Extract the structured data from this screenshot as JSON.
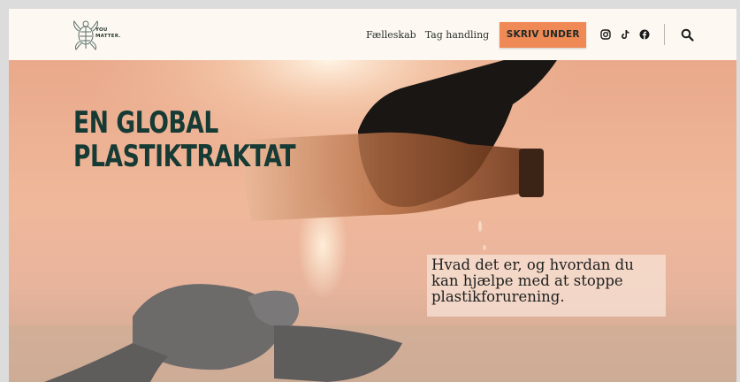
{
  "logo": {
    "line1": "YOU",
    "line2": "MATTER."
  },
  "nav": {
    "links": [
      "Fælleskab",
      "Tag handling"
    ],
    "cta_label": "SKRIV UNDER"
  },
  "icons": [
    "instagram-icon",
    "tiktok-icon",
    "facebook-icon",
    "search-icon"
  ],
  "hero": {
    "title_line1": "EN GLOBAL",
    "title_line2": "PLASTIKTRAKTAT",
    "subtitle": "Hvad det er, og hvordan du kan hjælpe med at stoppe plastikforurening."
  },
  "colors": {
    "cta": "#ef8a56",
    "title": "#163a34",
    "header_bg": "#fdf9f2"
  }
}
